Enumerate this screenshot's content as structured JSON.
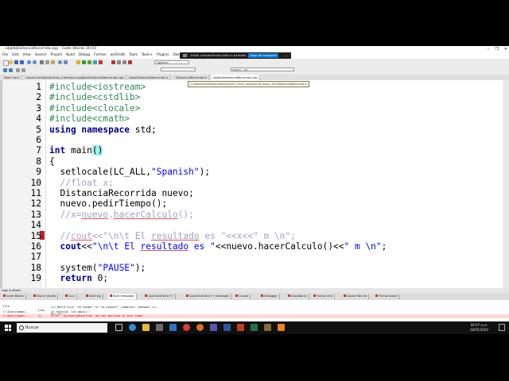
{
  "window": {
    "title": "objetoDistanciaRecorrida.cpp - Code::Blocks 20.03",
    "controls": [
      "–",
      "❐",
      "✕"
    ]
  },
  "menubar": [
    "File",
    "Edit",
    "View",
    "Search",
    "Project",
    "Build",
    "Debug",
    "Fortran",
    "wxSmith",
    "Tools",
    "Tools+",
    "Plugins",
    "DoxyBlocks",
    "Settings",
    "Help"
  ],
  "toolbar": {
    "scope_value": "<global>",
    "function_value": "main() : int"
  },
  "screen_share": {
    "message": "Estás compartiendo toda tu pantalla.",
    "stop_button": "Dejar de compartir",
    "close": "—"
  },
  "tabs": [
    "Start here",
    "claseCuentaDeAhorros_interface.cpp",
    "claseDistanciaRecorrida.cpp",
    "claseDistanciaRecorrida.h",
    "DistanciaRecorrida.h",
    "objetoDistanciaRecorrida.cpp"
  ],
  "tooltip": "C:\\Users\\meme\\Documents\\2020_CI202_grupoS2\\28_mayo_2020\\DistanciaRecorrida.h",
  "code_lines": [
    {
      "n": "1",
      "parts": [
        {
          "t": "#include<iostream>",
          "c": "pp"
        }
      ]
    },
    {
      "n": "2",
      "parts": [
        {
          "t": "#include<cstdlib>",
          "c": "pp"
        }
      ]
    },
    {
      "n": "3",
      "parts": [
        {
          "t": "#include<clocale>",
          "c": "pp"
        }
      ]
    },
    {
      "n": "4",
      "parts": [
        {
          "t": "#include<cmath>",
          "c": "pp"
        }
      ]
    },
    {
      "n": "5",
      "parts": [
        {
          "t": "using namespace",
          "c": "kw"
        },
        {
          "t": " std;",
          "c": ""
        }
      ]
    },
    {
      "n": "6",
      "parts": []
    },
    {
      "n": "7",
      "parts": [
        {
          "t": "int",
          "c": "kw"
        },
        {
          "t": " main",
          "c": ""
        },
        {
          "t": "()",
          "c": "hl"
        }
      ]
    },
    {
      "n": "8",
      "parts": [
        {
          "t": "{",
          "c": ""
        }
      ]
    },
    {
      "n": "9",
      "parts": [
        {
          "t": "  setlocale(LC_ALL,",
          "c": ""
        },
        {
          "t": "\"Spanish\"",
          "c": "str"
        },
        {
          "t": ");",
          "c": ""
        }
      ]
    },
    {
      "n": "10",
      "parts": [
        {
          "t": "  //float x;",
          "c": "cm"
        }
      ]
    },
    {
      "n": "11",
      "parts": [
        {
          "t": "  DistanciaRecorrida nuevo;",
          "c": ""
        }
      ]
    },
    {
      "n": "12",
      "parts": [
        {
          "t": "  nuevo.pedirTiempo();",
          "c": ""
        }
      ]
    },
    {
      "n": "13",
      "parts": [
        {
          "t": "  //x=",
          "c": "cm"
        },
        {
          "t": "nuevo",
          "c": "cm und"
        },
        {
          "t": ".",
          "c": "cm"
        },
        {
          "t": "hacerCalculo",
          "c": "cm und"
        },
        {
          "t": "();",
          "c": "cm"
        }
      ]
    },
    {
      "n": "14",
      "parts": []
    },
    {
      "n": "15",
      "parts": [
        {
          "t": "  //",
          "c": "cm"
        },
        {
          "t": "cout",
          "c": "cm und"
        },
        {
          "t": "<<\"\\n\\t El ",
          "c": "cm"
        },
        {
          "t": "resultado",
          "c": "cm und"
        },
        {
          "t": " es \"<<x<<\" m \\n\";",
          "c": "cm"
        }
      ]
    },
    {
      "n": "16",
      "parts": [
        {
          "t": "  cout",
          "c": "kw"
        },
        {
          "t": "<<",
          "c": ""
        },
        {
          "t": "\"\\n\\t El ",
          "c": "str"
        },
        {
          "t": "resultado",
          "c": "str und"
        },
        {
          "t": " es \"",
          "c": "str"
        },
        {
          "t": "<<nuevo.hacerCalculo()<<",
          "c": ""
        },
        {
          "t": "\" m \\n\"",
          "c": "str"
        },
        {
          "t": ";",
          "c": ""
        }
      ]
    },
    {
      "n": "17",
      "parts": []
    },
    {
      "n": "18",
      "parts": [
        {
          "t": "  system(",
          "c": ""
        },
        {
          "t": "\"PAUSE\"",
          "c": "str"
        },
        {
          "t": ");",
          "c": ""
        }
      ]
    },
    {
      "n": "19",
      "parts": [
        {
          "t": "  return",
          "c": "kw"
        },
        {
          "t": " 0;",
          "c": ""
        }
      ]
    }
  ],
  "logs": {
    "title": "Logs & others",
    "tabs": [
      "Code::Blocks",
      "Search results",
      "Cccc",
      "Build log",
      "Build messages",
      "CppCheck/Vera++",
      "CppCheck/Vera++ messages",
      "Cscope",
      "Debugger",
      "DoxyBlocks",
      "Fortran info",
      "Closed files list",
      "Thread search"
    ],
    "headers": {
      "file": "File",
      "line": "Line",
      "message": "Message"
    },
    "rows": [
      {
        "file": "",
        "line": "",
        "message": "=== Build file: \"no target\" in \"no project\" (compiler: unknown) ===",
        "error": false
      },
      {
        "file": "C:\\Users\\meme\\...",
        "line": "",
        "message": "In function 'int main()':",
        "error": false
      },
      {
        "file": "C:\\Users\\meme\\...",
        "line": "11",
        "message": "error: 'DistanciaRecorrida' was not declared in this scope",
        "error": true
      }
    ]
  },
  "taskbar": {
    "search_placeholder": "Buscar",
    "time": "09:07 a.m.",
    "date": "28/05/2020"
  }
}
